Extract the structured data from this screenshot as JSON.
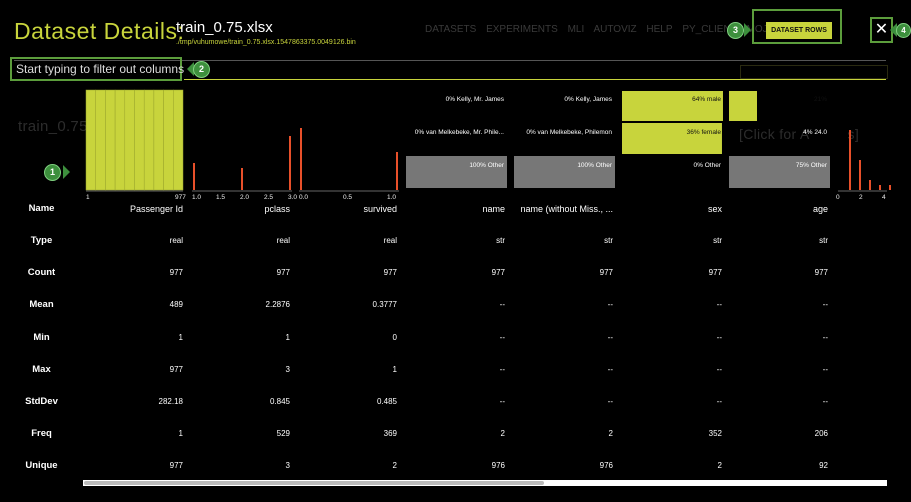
{
  "header": {
    "title": "Dataset Details:",
    "filename": "train_0.75.xlsx",
    "filepath": "./tmp/vuhumowe/train_0.75.xlsx.1547863375.0049126.bin"
  },
  "background": {
    "nav_items": [
      "DATASETS",
      "EXPERIMENTS",
      "MLI",
      "AUTOVIZ",
      "HELP",
      "PY_CLIENT",
      "MOJO2-R"
    ],
    "ghost_title": "train_0.75.x",
    "ghost_click": "[Click for A",
    "ghost_click_suffix": "s]"
  },
  "filter": {
    "placeholder": "Start typing to filter out columns"
  },
  "buttons": {
    "dataset_rows": "DATASET ROWS",
    "close": "✕"
  },
  "markers": [
    "1",
    "2",
    "3",
    "4"
  ],
  "colors": {
    "accent": "#c8d43c",
    "bar_red": "#e8502a",
    "other_gray": "#777777",
    "annotation_green": "#3d8f3d"
  },
  "stat_labels": [
    "Name",
    "Type",
    "Count",
    "Mean",
    "Min",
    "Max",
    "StdDev",
    "Freq",
    "Unique"
  ],
  "columns": [
    {
      "name": "Passenger Id",
      "type": "real",
      "count": "977",
      "mean": "489",
      "min": "1",
      "max": "977",
      "stddev": "282.18",
      "freq": "1",
      "unique": "977"
    },
    {
      "name": "pclass",
      "type": "real",
      "count": "977",
      "mean": "2.2876",
      "min": "1",
      "max": "3",
      "stddev": "0.845",
      "freq": "529",
      "unique": "3"
    },
    {
      "name": "survived",
      "type": "real",
      "count": "977",
      "mean": "0.3777",
      "min": "0",
      "max": "1",
      "stddev": "0.485",
      "freq": "369",
      "unique": "2"
    },
    {
      "name": "name",
      "type": "str",
      "count": "977",
      "mean": "--",
      "min": "--",
      "max": "--",
      "stddev": "--",
      "freq": "2",
      "unique": "976"
    },
    {
      "name": "name (without Miss., ...",
      "type": "str",
      "count": "977",
      "mean": "--",
      "min": "--",
      "max": "--",
      "stddev": "--",
      "freq": "2",
      "unique": "976"
    },
    {
      "name": "sex",
      "type": "str",
      "count": "977",
      "mean": "--",
      "min": "--",
      "max": "--",
      "stddev": "--",
      "freq": "352",
      "unique": "2"
    },
    {
      "name": "age",
      "type": "str",
      "count": "977",
      "mean": "--",
      "min": "--",
      "max": "--",
      "stddev": "--",
      "freq": "206",
      "unique": "92"
    }
  ],
  "chart_data": [
    {
      "type": "bar",
      "column": "Passenger Id",
      "x_ticks": [
        "1",
        "977"
      ],
      "values": [
        1,
        1,
        1,
        1,
        1,
        1,
        1,
        1,
        1,
        1
      ]
    },
    {
      "type": "bar",
      "column": "pclass",
      "x_ticks": [
        "1.0",
        "1.5",
        "2.0",
        "2.5",
        "3.0"
      ],
      "x": [
        1.0,
        2.0,
        3.0
      ],
      "values": [
        0.27,
        0.22,
        0.54
      ]
    },
    {
      "type": "bar",
      "column": "survived",
      "x_ticks": [
        "0.0",
        "0.5",
        "1.0"
      ],
      "x": [
        0.0,
        1.0
      ],
      "values": [
        0.62,
        0.38
      ]
    },
    {
      "type": "bar",
      "column": "name",
      "stacked": true,
      "segments": [
        {
          "label": "0% Kelly, Mr. James",
          "value": 0
        },
        {
          "label": "0% van Melkebeke, Mr. Phile...",
          "value": 0
        },
        {
          "label": "100% Other",
          "value": 100
        }
      ]
    },
    {
      "type": "bar",
      "column": "name (without Miss., ...",
      "stacked": true,
      "segments": [
        {
          "label": "0% Kelly, James",
          "value": 0
        },
        {
          "label": "0% van Melkebeke, Philemon",
          "value": 0
        },
        {
          "label": "100% Other",
          "value": 100
        }
      ]
    },
    {
      "type": "bar",
      "column": "sex",
      "stacked": true,
      "segments": [
        {
          "label": "64% male",
          "value": 64
        },
        {
          "label": "36% female",
          "value": 36
        },
        {
          "label": "0% Other",
          "value": 0
        }
      ]
    },
    {
      "type": "bar",
      "column": "age",
      "stacked": true,
      "segments": [
        {
          "label": "21%",
          "value": 21
        },
        {
          "label": "4% 24.0",
          "value": 4
        },
        {
          "label": "75% Other",
          "value": 75
        }
      ]
    },
    {
      "type": "bar",
      "column": "(next)",
      "x_ticks": [
        "0",
        "2",
        "4"
      ],
      "values": [
        0.6,
        0.3,
        0.1,
        0.05,
        0.05
      ]
    }
  ]
}
